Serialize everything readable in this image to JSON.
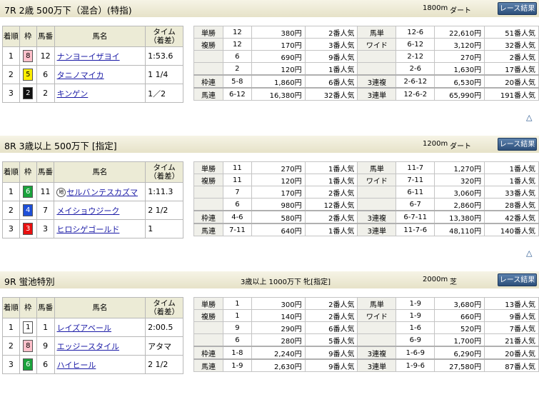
{
  "races": [
    {
      "title": "7R 2歳 500万下（混合）(特指)",
      "conditions": "",
      "distance": "1800m",
      "surface": "ダート",
      "button_label": "レース結果",
      "headers": [
        "着順",
        "枠",
        "馬番",
        "馬名",
        "タイム（着差）"
      ],
      "results": [
        {
          "pos": "1",
          "waku": "8",
          "waku_bg": "#ffc0cb",
          "waku_fg": "#000",
          "ban": "12",
          "name": "ナンヨーイザヨイ",
          "mark": "",
          "time": "1:53.6"
        },
        {
          "pos": "2",
          "waku": "5",
          "waku_bg": "#ffee00",
          "waku_fg": "#000",
          "ban": "6",
          "name": "タニノマイカ",
          "mark": "",
          "time": "1 1/4"
        },
        {
          "pos": "3",
          "waku": "2",
          "waku_bg": "#111111",
          "waku_fg": "#fff",
          "ban": "2",
          "name": "キンゲン",
          "mark": "",
          "time": "1／2"
        }
      ],
      "payouts": [
        [
          "単勝",
          "12",
          "380円",
          "2番人気",
          "馬単",
          "12-6",
          "22,610円",
          "51番人気"
        ],
        [
          "複勝",
          "12",
          "170円",
          "3番人気",
          "ワイド",
          "6-12",
          "3,120円",
          "32番人気"
        ],
        [
          "",
          "6",
          "690円",
          "9番人気",
          "",
          "2-12",
          "270円",
          "2番人気"
        ],
        [
          "",
          "2",
          "120円",
          "1番人気",
          "",
          "2-6",
          "1,630円",
          "17番人気"
        ],
        [
          "枠連",
          "5-8",
          "1,860円",
          "6番人気",
          "3連複",
          "2-6-12",
          "6,530円",
          "20番人気"
        ],
        [
          "馬連",
          "6-12",
          "16,380円",
          "32番人気",
          "3連単",
          "12-6-2",
          "65,990円",
          "191番人気"
        ]
      ]
    },
    {
      "title": "8R 3歳以上 500万下 [指定]",
      "conditions": "",
      "distance": "1200m",
      "surface": "ダート",
      "button_label": "レース結果",
      "headers": [
        "着順",
        "枠",
        "馬番",
        "馬名",
        "タイム（着差）"
      ],
      "results": [
        {
          "pos": "1",
          "waku": "6",
          "waku_bg": "#1aa33c",
          "waku_fg": "#fff",
          "ban": "11",
          "name": "セルバンテスカズマ",
          "mark": "地",
          "time": "1:11.3"
        },
        {
          "pos": "2",
          "waku": "4",
          "waku_bg": "#1e4fd8",
          "waku_fg": "#fff",
          "ban": "7",
          "name": "メイショウジーク",
          "mark": "",
          "time": "2 1/2"
        },
        {
          "pos": "3",
          "waku": "3",
          "waku_bg": "#e81010",
          "waku_fg": "#fff",
          "ban": "3",
          "name": "ヒロシゲゴールド",
          "mark": "",
          "time": "1"
        }
      ],
      "payouts": [
        [
          "単勝",
          "11",
          "270円",
          "1番人気",
          "馬単",
          "11-7",
          "1,270円",
          "1番人気"
        ],
        [
          "複勝",
          "11",
          "120円",
          "1番人気",
          "ワイド",
          "7-11",
          "320円",
          "1番人気"
        ],
        [
          "",
          "7",
          "170円",
          "2番人気",
          "",
          "6-11",
          "3,060円",
          "33番人気"
        ],
        [
          "",
          "6",
          "980円",
          "12番人気",
          "",
          "6-7",
          "2,860円",
          "28番人気"
        ],
        [
          "枠連",
          "4-6",
          "580円",
          "2番人気",
          "3連複",
          "6-7-11",
          "13,380円",
          "42番人気"
        ],
        [
          "馬連",
          "7-11",
          "640円",
          "1番人気",
          "3連単",
          "11-7-6",
          "48,110円",
          "140番人気"
        ]
      ]
    },
    {
      "title": "9R 蛍池特別",
      "conditions": "3歳以上 1000万下 牝[指定]",
      "distance": "2000m",
      "surface": "芝",
      "button_label": "レース結果",
      "headers": [
        "着順",
        "枠",
        "馬番",
        "馬名",
        "タイム（着差）"
      ],
      "results": [
        {
          "pos": "1",
          "waku": "1",
          "waku_bg": "#ffffff",
          "waku_fg": "#000",
          "ban": "1",
          "name": "レイズアベール",
          "mark": "",
          "time": "2:00.5"
        },
        {
          "pos": "2",
          "waku": "8",
          "waku_bg": "#ffc0cb",
          "waku_fg": "#000",
          "ban": "9",
          "name": "エッジースタイル",
          "mark": "",
          "time": "アタマ"
        },
        {
          "pos": "3",
          "waku": "6",
          "waku_bg": "#1aa33c",
          "waku_fg": "#fff",
          "ban": "6",
          "name": "ハイヒール",
          "mark": "",
          "time": "2 1/2"
        }
      ],
      "payouts": [
        [
          "単勝",
          "1",
          "300円",
          "2番人気",
          "馬単",
          "1-9",
          "3,680円",
          "13番人気"
        ],
        [
          "複勝",
          "1",
          "140円",
          "2番人気",
          "ワイド",
          "1-9",
          "660円",
          "9番人気"
        ],
        [
          "",
          "9",
          "290円",
          "6番人気",
          "",
          "1-6",
          "520円",
          "7番人気"
        ],
        [
          "",
          "6",
          "280円",
          "5番人気",
          "",
          "6-9",
          "1,700円",
          "21番人気"
        ],
        [
          "枠連",
          "1-8",
          "2,240円",
          "9番人気",
          "3連複",
          "1-6-9",
          "6,290円",
          "20番人気"
        ],
        [
          "馬連",
          "1-9",
          "2,630円",
          "9番人気",
          "3連単",
          "1-9-6",
          "27,580円",
          "87番人気"
        ]
      ]
    }
  ],
  "top_link": "△"
}
